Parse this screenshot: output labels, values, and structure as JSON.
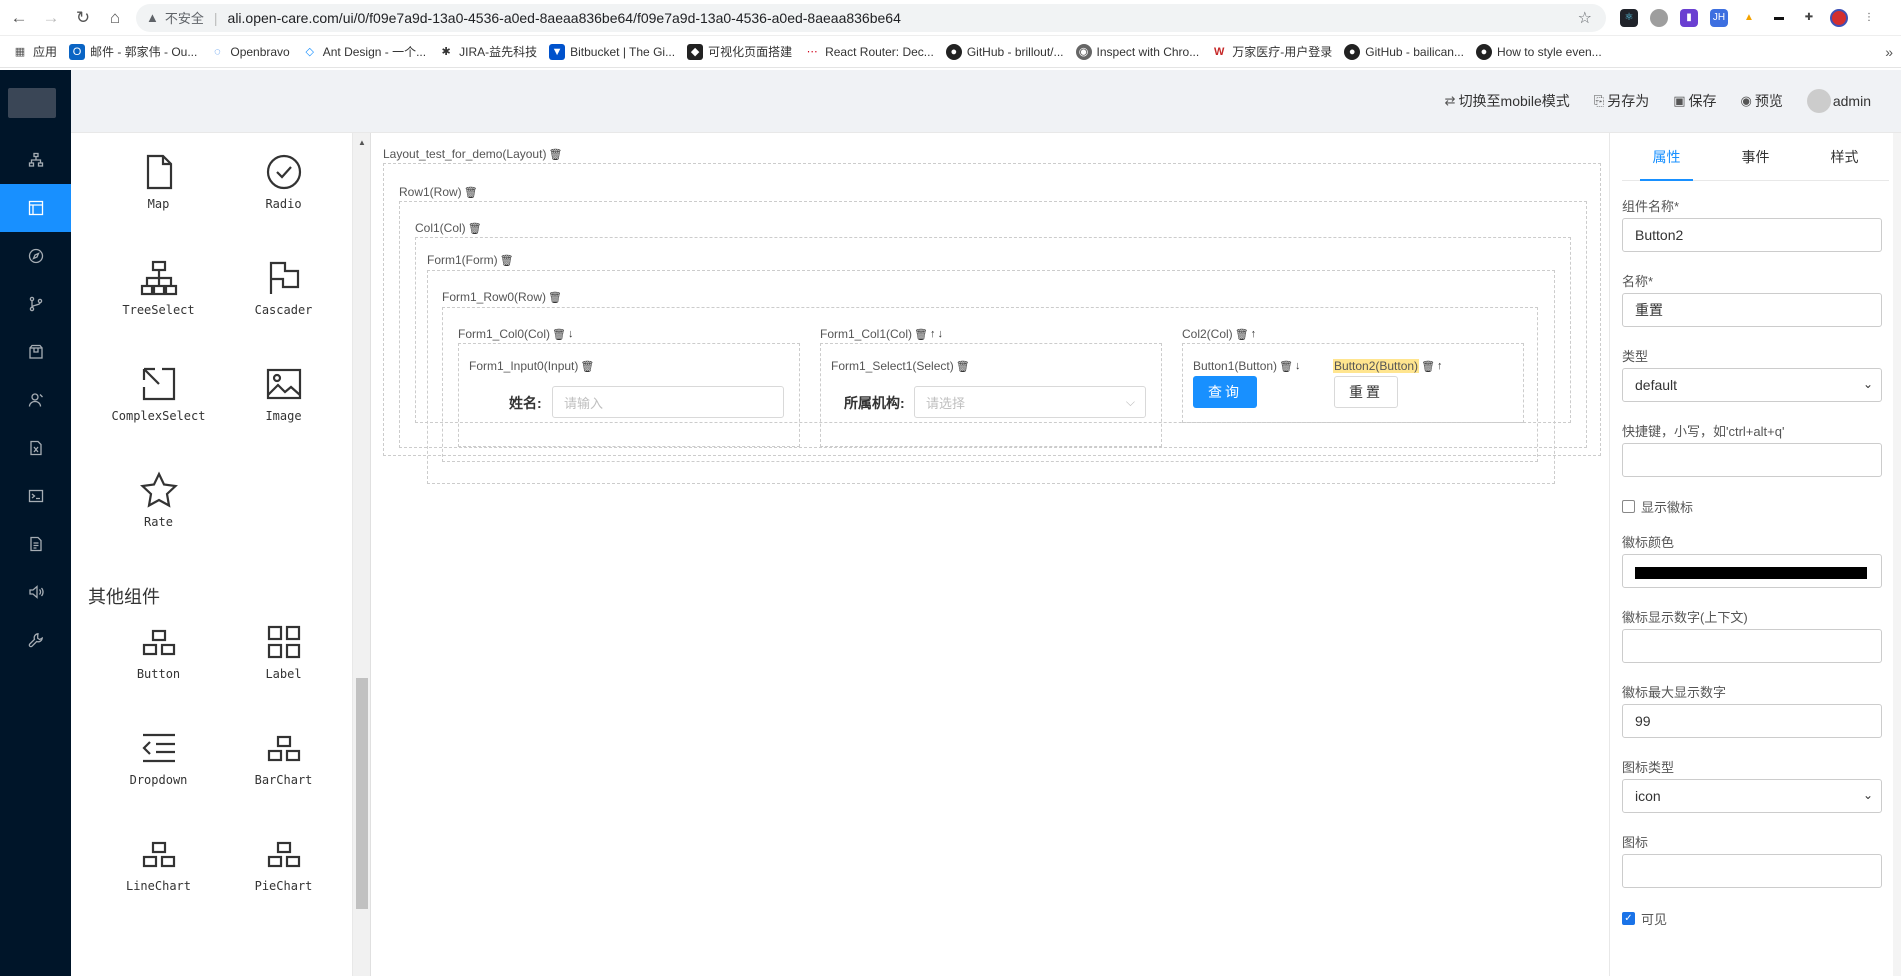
{
  "browser": {
    "insecure_label": "不安全",
    "url": "ali.open-care.com/ui/0/f09e7a9d-13a0-4536-a0ed-8aeaa836be64/f09e7a9d-13a0-4536-a0ed-8aeaa836be64",
    "bookmarks": [
      "应用",
      "邮件 - 郭家伟 - Ou...",
      "Openbravo",
      "Ant Design - 一个...",
      "JIRA-益先科技",
      "Bitbucket | The Gi...",
      "可视化页面搭建",
      "React Router: Dec...",
      "GitHub - brillout/...",
      "Inspect with Chro...",
      "万家医疗-用户登录",
      "GitHub - bailican...",
      "How to style even..."
    ]
  },
  "header": {
    "switch_mobile": "切换至mobile模式",
    "save_as": "另存为",
    "save": "保存",
    "preview": "预览",
    "user": "admin"
  },
  "palette": {
    "components_top": [
      "Map",
      "Radio",
      "TreeSelect",
      "Cascader",
      "ComplexSelect",
      "Image",
      "Rate"
    ],
    "other_title": "其他组件",
    "components_other": [
      "Button",
      "Label",
      "Dropdown",
      "BarChart",
      "LineChart",
      "PieChart"
    ]
  },
  "canvas": {
    "layout": "Layout_test_for_demo(Layout)",
    "row1": "Row1(Row)",
    "col1": "Col1(Col)",
    "form1": "Form1(Form)",
    "form_row0": "Form1_Row0(Row)",
    "form_col0": "Form1_Col0(Col)",
    "form_col1": "Form1_Col1(Col)",
    "col2": "Col2(Col)",
    "input0": "Form1_Input0(Input)",
    "select1": "Form1_Select1(Select)",
    "button1": "Button1(Button)",
    "button2": "Button2(Button)",
    "name_label": "姓名:",
    "name_placeholder": "请输入",
    "org_label": "所属机构:",
    "org_placeholder": "请选择",
    "query_btn": "查询",
    "reset_btn": "重置"
  },
  "props": {
    "tabs": [
      "属性",
      "事件",
      "样式"
    ],
    "component_name_label": "组件名称*",
    "component_name_value": "Button2",
    "name_label": "名称*",
    "name_value": "重置",
    "type_label": "类型",
    "type_value": "default",
    "hotkey_label": "快捷键，小写，如'ctrl+alt+q'",
    "hotkey_value": "",
    "show_badge_label": "显示徽标",
    "badge_color_label": "徽标颜色",
    "badge_color": "#000000",
    "badge_number_label": "徽标显示数字(上下文)",
    "badge_number_value": "",
    "badge_max_label": "徽标最大显示数字",
    "badge_max_value": "99",
    "icon_type_label": "图标类型",
    "icon_type_value": "icon",
    "icon_label": "图标",
    "icon_value": "",
    "visible_label": "可见"
  },
  "colors": {
    "accent": "#1890ff",
    "sidebar": "#001529",
    "highlight": "#ffe58f"
  }
}
